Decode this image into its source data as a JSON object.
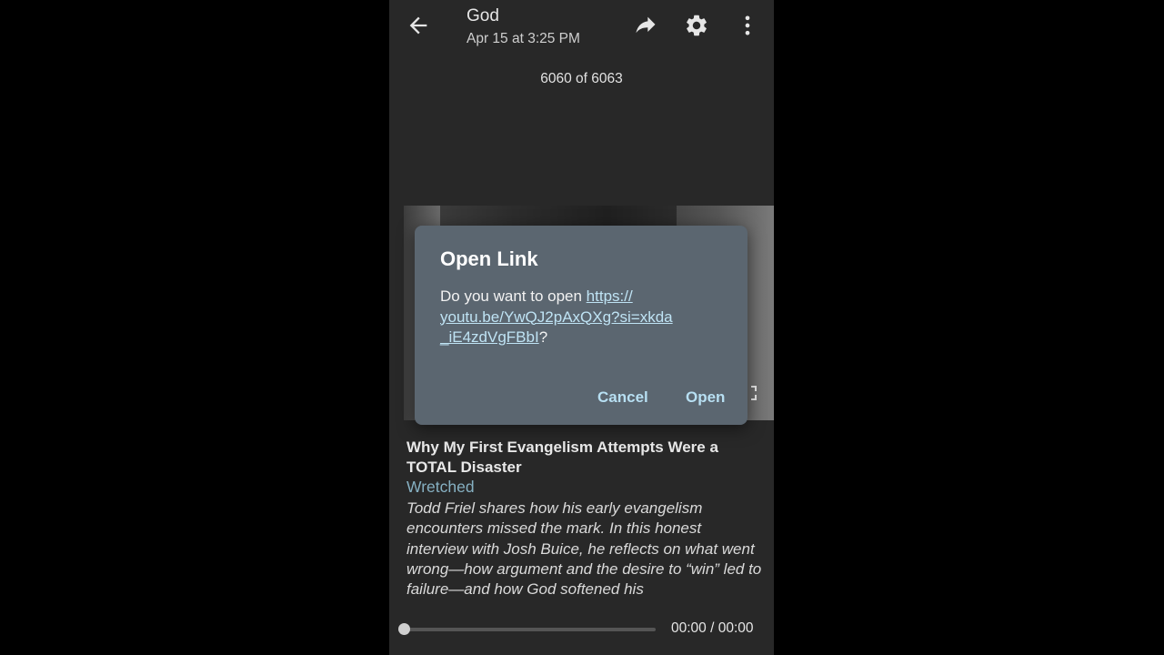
{
  "header": {
    "title": "God",
    "subtitle": "Apr 15 at 3:25 PM",
    "back_icon": "arrow-left-icon",
    "share_icon": "share-arrow-icon",
    "settings_icon": "gear-icon",
    "menu_icon": "more-vertical-icon"
  },
  "counter": "6060 of 6063",
  "dialog": {
    "title": "Open Link",
    "prompt": "Do you want to open ",
    "url": "https://​youtu.be/YwQJ2pAxQXg?si=xkda​_iE4zdVgFBbI",
    "suffix": "?",
    "cancel_label": "Cancel",
    "open_label": "Open"
  },
  "video": {
    "title": "Why My First Evangelism Attempts Were a TOTAL Disaster",
    "channel": "Wretched",
    "description": "Todd Friel shares how his early evangelism encounters missed the mark. In this honest interview with Josh Buice, he reflects on what went wrong—how argument and the desire to “win” led to failure—and how God softened his"
  },
  "player": {
    "time": "00:00 / 00:00",
    "progress": 0
  },
  "colors": {
    "background": "#282828",
    "dialog": "#5b6670",
    "accent": "#b7dff2",
    "channel": "#86b0c2"
  }
}
